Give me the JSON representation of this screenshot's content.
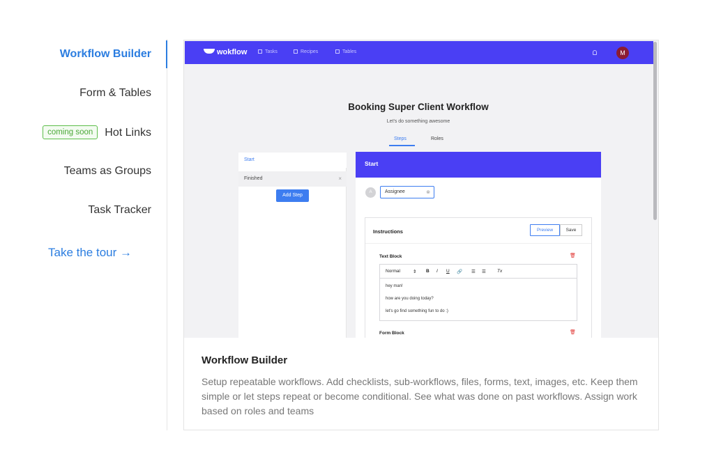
{
  "nav": {
    "items": [
      {
        "label": "Workflow Builder",
        "active": true
      },
      {
        "label": "Form & Tables"
      },
      {
        "label": "Hot Links",
        "badge": "coming soon"
      },
      {
        "label": "Teams as Groups"
      },
      {
        "label": "Task Tracker"
      }
    ],
    "tour_label": "Take the tour →"
  },
  "app": {
    "brand": "wokflow",
    "topnav": [
      "Tasks",
      "Recipes",
      "Tables"
    ],
    "avatar_initial": "M",
    "workflow_title": "Booking Super Client Workflow",
    "workflow_subtitle": "Let's do something awesome",
    "tabs": [
      "Steps",
      "Roles"
    ],
    "steps": [
      "Start",
      "Finished"
    ],
    "add_step_label": "Add Step",
    "panel_title": "Start",
    "assignee_initial": "A",
    "assignee_label": "Assignee",
    "instructions_label": "Instructions",
    "preview_label": "Preview",
    "save_label": "Save",
    "text_block_label": "Text Block",
    "form_block_label": "Form Block",
    "editor_toolbar": {
      "format": "Normal",
      "bold": "B",
      "italic": "I",
      "underline": "U",
      "clear": "Tx"
    },
    "editor_lines": [
      "hey man!",
      "how are you doing today?",
      "let's go find something fun to do :)"
    ]
  },
  "caption": {
    "title": "Workflow Builder",
    "text": "Setup repeatable workflows. Add checklists, sub-workflows, files, forms, text, images, etc. Keep them simple or let steps repeat or become conditional. See what was done on past workflows. Assign work based on roles and teams"
  },
  "colors": {
    "accent": "#2b7de0",
    "app_header": "#4a3ff4",
    "badge_green": "#4aa837",
    "danger": "#e0322f"
  }
}
